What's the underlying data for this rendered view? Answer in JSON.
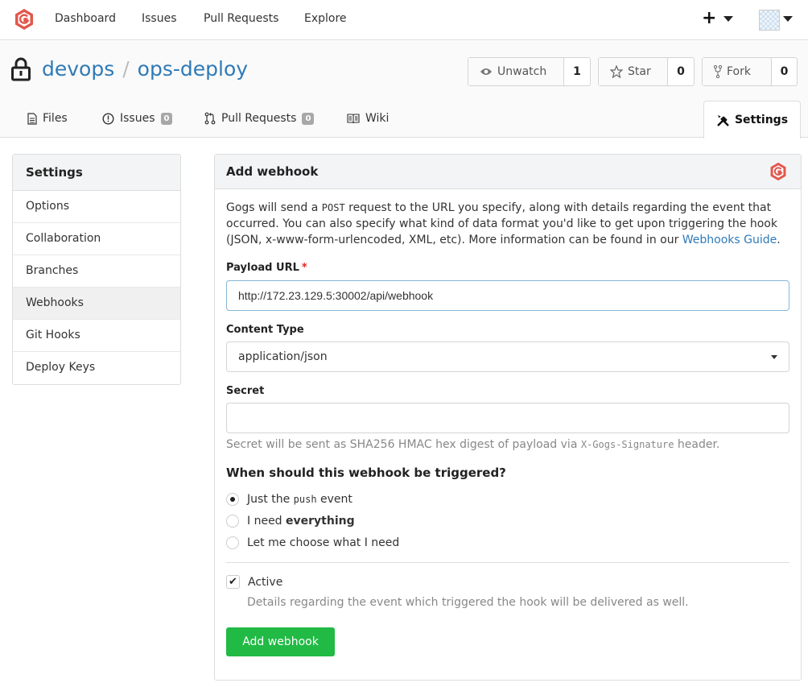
{
  "nav": {
    "items": [
      "Dashboard",
      "Issues",
      "Pull Requests",
      "Explore"
    ],
    "plus": "+"
  },
  "repo": {
    "owner": "devops",
    "separator": "/",
    "name": "ops-deploy",
    "watch_label": "Unwatch",
    "watch_count": "1",
    "star_label": "Star",
    "star_count": "0",
    "fork_label": "Fork",
    "fork_count": "0"
  },
  "tabs": {
    "files": "Files",
    "issues": "Issues",
    "issues_count": "0",
    "pulls": "Pull Requests",
    "pulls_count": "0",
    "wiki": "Wiki",
    "settings": "Settings"
  },
  "sidebar": {
    "title": "Settings",
    "items": [
      "Options",
      "Collaboration",
      "Branches",
      "Webhooks",
      "Git Hooks",
      "Deploy Keys"
    ],
    "active": "Webhooks"
  },
  "form": {
    "title": "Add webhook",
    "desc_1": "Gogs will send a ",
    "desc_code": "POST",
    "desc_2": " request to the URL you specify, along with details regarding the event that occurred. You can also specify what kind of data format you'd like to get upon triggering the hook (JSON, x-www-form-urlencoded, XML, etc). More information can be found in our ",
    "desc_link": "Webhooks Guide",
    "desc_3": ".",
    "payload_label": "Payload URL",
    "required_mark": "*",
    "payload_value": "http://172.23.129.5:30002/api/webhook",
    "content_type_label": "Content Type",
    "content_type_value": "application/json",
    "secret_label": "Secret",
    "secret_value": "",
    "secret_help_1": "Secret will be sent as SHA256 HMAC hex digest of payload via ",
    "secret_help_code": "X-Gogs-Signature",
    "secret_help_2": " header.",
    "trigger_title": "When should this webhook be triggered?",
    "opt_push_1": "Just the ",
    "opt_push_code": "push",
    "opt_push_2": " event",
    "opt_all_1": "I need ",
    "opt_all_bold": "everything",
    "opt_choose": "Let me choose what I need",
    "active_label": "Active",
    "active_help": "Details regarding the event which triggered the hook will be delivered as well.",
    "submit": "Add webhook",
    "selected_trigger": "push",
    "active_checked": true
  },
  "colors": {
    "brand": "#e2574c",
    "link": "#2f7ab7",
    "submit": "#21ba45"
  }
}
